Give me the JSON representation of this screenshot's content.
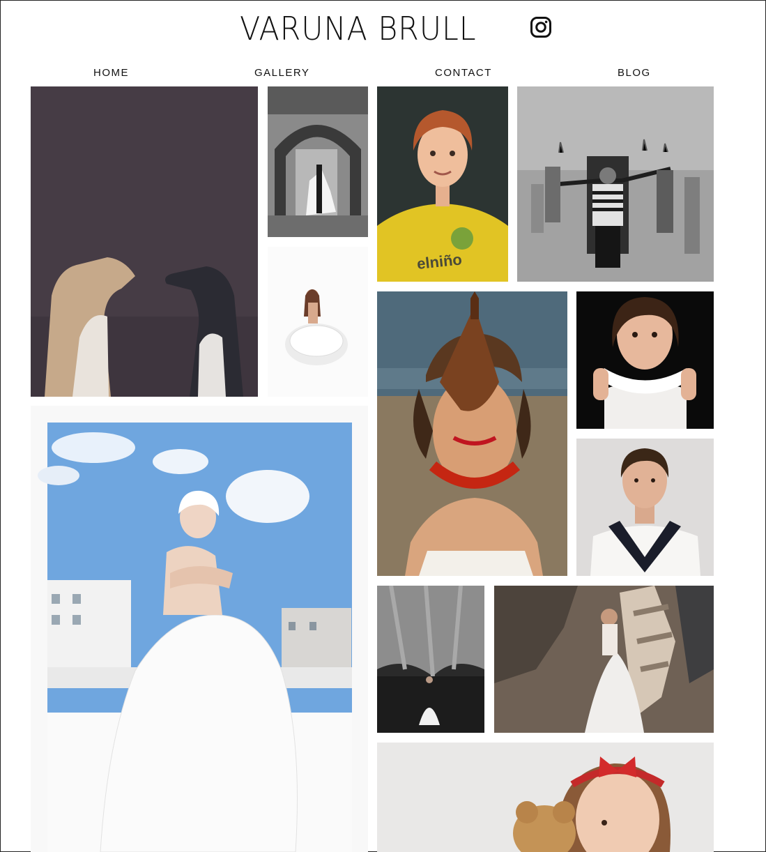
{
  "site": {
    "title": "VARUNA BRULL"
  },
  "nav": {
    "home": "HOME",
    "gallery": "GALLERY",
    "contact": "CONTACT",
    "blog": "BLOG"
  },
  "icons": {
    "social": "instagram-icon"
  },
  "colors": {
    "text": "#111111",
    "background": "#ffffff"
  }
}
